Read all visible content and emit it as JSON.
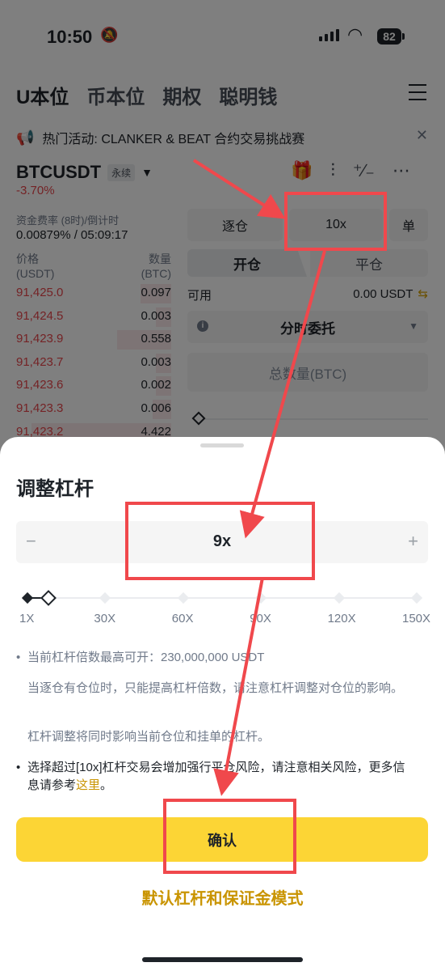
{
  "status_bar": {
    "time": "10:50",
    "battery": "82"
  },
  "top_tabs": [
    "U本位",
    "币本位",
    "期权",
    "聪明钱"
  ],
  "notice": {
    "text": "热门活动: CLANKER & BEAT 合约交易挑战赛"
  },
  "symbol": {
    "name": "BTCUSDT",
    "badge": "永续",
    "change": "-3.70%"
  },
  "funding": {
    "label": "资金费率 (8时)/倒计时",
    "value": "0.00879% / 05:09:17"
  },
  "orderbook": {
    "price_header": "价格",
    "price_unit": "(USDT)",
    "qty_header": "数量",
    "qty_unit": "(BTC)",
    "rows": [
      {
        "price": "91,425.0",
        "qty": "0.097",
        "depth": 0.2
      },
      {
        "price": "91,424.5",
        "qty": "0.003",
        "depth": 0.1
      },
      {
        "price": "91,423.9",
        "qty": "0.558",
        "depth": 0.35
      },
      {
        "price": "91,423.7",
        "qty": "0.003",
        "depth": 0.1
      },
      {
        "price": "91,423.6",
        "qty": "0.002",
        "depth": 0.1
      },
      {
        "price": "91,423.3",
        "qty": "0.006",
        "depth": 0.12
      },
      {
        "price": "91,423.2",
        "qty": "4.422",
        "depth": 0.9
      }
    ]
  },
  "trade_panel": {
    "margin_mode": "逐仓",
    "leverage": "10x",
    "position_mode": "单",
    "open_tab": "开仓",
    "close_tab": "平仓",
    "available_label": "可用",
    "available_value": "0.00 USDT",
    "order_type": "分时委托",
    "qty_placeholder": "总数量(BTC)"
  },
  "sheet": {
    "title": "调整杠杆",
    "minus": "−",
    "plus": "+",
    "value": "9x",
    "slider_labels": [
      "1X",
      "30X",
      "60X",
      "90X",
      "120X",
      "150X"
    ],
    "slider_min": 1,
    "slider_max": 150,
    "slider_current": 9,
    "note1": "当前杠杆倍数最高可开：230,000,000 USDT",
    "note2": "当逐仓有仓位时，只能提高杠杆倍数，请注意杠杆调整对仓位的影响。",
    "note3": "杠杆调整将同时影响当前仓位和挂单的杠杆。",
    "warning": "选择超过[10x]杠杆交易会增加强行平仓风险，请注意相关风险，更多信息请参考",
    "warning_link": "这里",
    "warning_end": "。",
    "confirm": "确认",
    "default_link": "默认杠杆和保证金模式"
  },
  "colors": {
    "accent": "#fcd535",
    "down": "#e8474c",
    "link": "#c99400",
    "annotation": "#f0484c"
  }
}
